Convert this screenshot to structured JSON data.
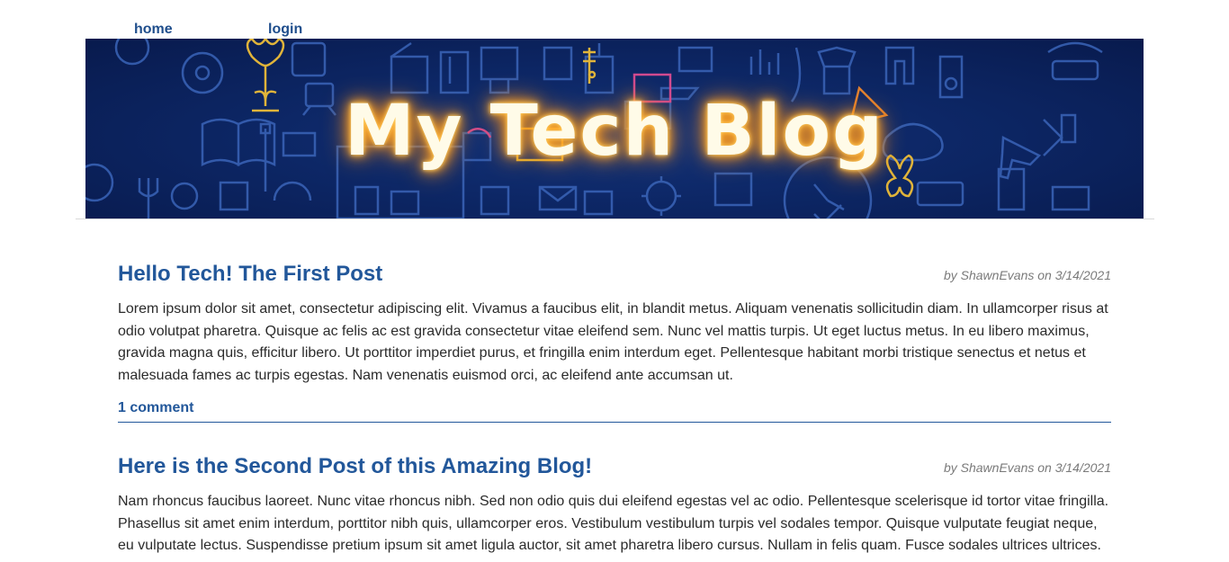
{
  "nav": {
    "home_label": "home",
    "login_label": "login"
  },
  "banner": {
    "title": "My Tech Blog",
    "background_color": "#0d2766",
    "glow_color": "#ff9a1f"
  },
  "posts": [
    {
      "title": "Hello Tech! The First Post",
      "meta": "by ShawnEvans on 3/14/2021",
      "body": "Lorem ipsum dolor sit amet, consectetur adipiscing elit. Vivamus a faucibus elit, in blandit metus. Aliquam venenatis sollicitudin diam. In ullamcorper risus at odio volutpat pharetra. Quisque ac felis ac est gravida consectetur vitae eleifend sem. Nunc vel mattis turpis. Ut eget luctus metus. In eu libero maximus, gravida magna quis, efficitur libero. Ut porttitor imperdiet purus, et fringilla enim interdum eget. Pellentesque habitant morbi tristique senectus et netus et malesuada fames ac turpis egestas. Nam venenatis euismod orci, ac eleifend ante accumsan ut.",
      "comments_label": "1 comment"
    },
    {
      "title": "Here is the Second Post of this Amazing Blog!",
      "meta": "by ShawnEvans on 3/14/2021",
      "body": "Nam rhoncus faucibus laoreet. Nunc vitae rhoncus nibh. Sed non odio quis dui eleifend egestas vel ac odio. Pellentesque scelerisque id tortor vitae fringilla. Phasellus sit amet enim interdum, porttitor nibh quis, ullamcorper eros. Vestibulum vestibulum turpis vel sodales tempor. Quisque vulputate feugiat neque, eu vulputate lectus. Suspendisse pretium ipsum sit amet ligula auctor, sit amet pharetra libero cursus. Nullam in felis quam. Fusce sodales ultrices ultrices."
    }
  ],
  "colors": {
    "link": "#22579a",
    "meta": "#7a7a7a",
    "text": "#2b2b2b"
  }
}
